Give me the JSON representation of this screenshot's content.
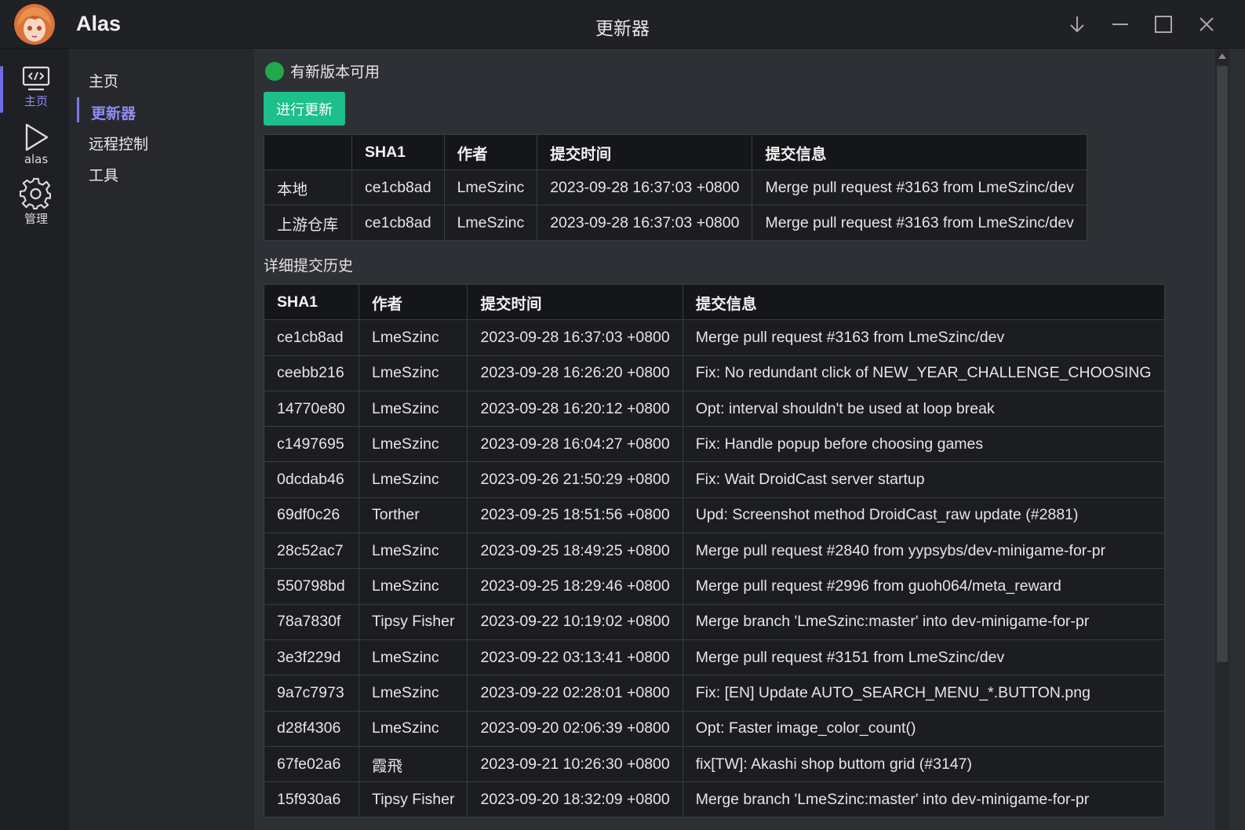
{
  "app": {
    "name": "Alas",
    "window_title": "更新器"
  },
  "rail": [
    {
      "label": "主页",
      "icon": "code-screen-icon",
      "active": true
    },
    {
      "label": "alas",
      "icon": "play-icon",
      "active": false
    },
    {
      "label": "管理",
      "icon": "gear-icon",
      "active": false
    }
  ],
  "subnav": [
    {
      "label": "主页"
    },
    {
      "label": "更新器"
    },
    {
      "label": "远程控制"
    },
    {
      "label": "工具"
    }
  ],
  "status": {
    "text": "有新版本可用",
    "color": "#22a84d"
  },
  "update_button": "进行更新",
  "version_table": {
    "headers": [
      "",
      "SHA1",
      "作者",
      "提交时间",
      "提交信息"
    ],
    "rows": [
      [
        "本地",
        "ce1cb8ad",
        "LmeSzinc",
        "2023-09-28 16:37:03 +0800",
        "Merge pull request #3163 from LmeSzinc/dev"
      ],
      [
        "上游仓库",
        "ce1cb8ad",
        "LmeSzinc",
        "2023-09-28 16:37:03 +0800",
        "Merge pull request #3163 from LmeSzinc/dev"
      ]
    ]
  },
  "history_title": "详细提交历史",
  "history_table": {
    "headers": [
      "SHA1",
      "作者",
      "提交时间",
      "提交信息"
    ],
    "rows": [
      [
        "ce1cb8ad",
        "LmeSzinc",
        "2023-09-28 16:37:03 +0800",
        "Merge pull request #3163 from LmeSzinc/dev"
      ],
      [
        "ceebb216",
        "LmeSzinc",
        "2023-09-28 16:26:20 +0800",
        "Fix: No redundant click of NEW_YEAR_CHALLENGE_CHOOSING"
      ],
      [
        "14770e80",
        "LmeSzinc",
        "2023-09-28 16:20:12 +0800",
        "Opt: interval shouldn't be used at loop break"
      ],
      [
        "c1497695",
        "LmeSzinc",
        "2023-09-28 16:04:27 +0800",
        "Fix: Handle popup before choosing games"
      ],
      [
        "0dcdab46",
        "LmeSzinc",
        "2023-09-26 21:50:29 +0800",
        "Fix: Wait DroidCast server startup"
      ],
      [
        "69df0c26",
        "Torther",
        "2023-09-25 18:51:56 +0800",
        "Upd: Screenshot method DroidCast_raw update (#2881)"
      ],
      [
        "28c52ac7",
        "LmeSzinc",
        "2023-09-25 18:49:25 +0800",
        "Merge pull request #2840 from yypsybs/dev-minigame-for-pr"
      ],
      [
        "550798bd",
        "LmeSzinc",
        "2023-09-25 18:29:46 +0800",
        "Merge pull request #2996 from guoh064/meta_reward"
      ],
      [
        "78a7830f",
        "Tipsy Fisher",
        "2023-09-22 10:19:02 +0800",
        "Merge branch 'LmeSzinc:master' into dev-minigame-for-pr"
      ],
      [
        "3e3f229d",
        "LmeSzinc",
        "2023-09-22 03:13:41 +0800",
        "Merge pull request #3151 from LmeSzinc/dev"
      ],
      [
        "9a7c7973",
        "LmeSzinc",
        "2023-09-22 02:28:01 +0800",
        "Fix: [EN] Update AUTO_SEARCH_MENU_*.BUTTON.png"
      ],
      [
        "d28f4306",
        "LmeSzinc",
        "2023-09-20 02:06:39 +0800",
        "Opt: Faster image_color_count()"
      ],
      [
        "67fe02a6",
        "霞飛",
        "2023-09-21 10:26:30 +0800",
        "fix[TW]: Akashi shop buttom grid (#3147)"
      ],
      [
        "15f930a6",
        "Tipsy Fisher",
        "2023-09-20 18:32:09 +0800",
        "Merge branch 'LmeSzinc:master' into dev-minigame-for-pr"
      ]
    ]
  }
}
